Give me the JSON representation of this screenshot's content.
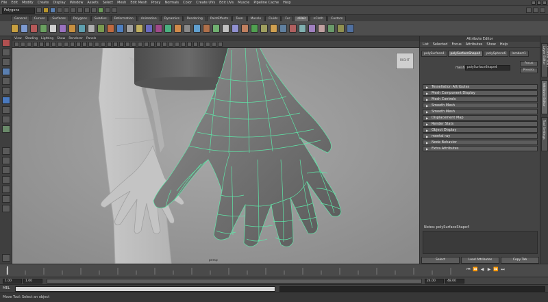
{
  "menubar": {
    "items": [
      "File",
      "Edit",
      "Modify",
      "Create",
      "Display",
      "Window",
      "Assets",
      "Select",
      "Mesh",
      "Edit Mesh",
      "Proxy",
      "Normals",
      "Color",
      "Create UVs",
      "Edit UVs",
      "Muscle",
      "Pipeline Cache",
      "Help"
    ]
  },
  "status": {
    "mode": "Polygons"
  },
  "shelf": {
    "tabs": [
      "General",
      "Curves",
      "Surfaces",
      "Polygons",
      "Subdivs",
      "Deformation",
      "Animation",
      "Dynamics",
      "Rendering",
      "PaintEffects",
      "Toon",
      "Muscle",
      "Fluids",
      "Fur",
      "nHair",
      "nCloth",
      "Custom"
    ],
    "active_tab": 14,
    "button_colors": [
      "#c8a040",
      "#7d9ad0",
      "#b65a5a",
      "#6aa060",
      "#d0d0d0",
      "#9a72c0",
      "#c89040",
      "#5fa0b0",
      "#b0b0b0",
      "#7a9a50",
      "#c06a40",
      "#5080c0",
      "#a0a0a0",
      "#c0b060",
      "#6a6ac0",
      "#a04a8a",
      "#4ab080",
      "#d08a4a",
      "#8a8a8a",
      "#60a0d0",
      "#b0704a",
      "#70b070",
      "#c0c0c0",
      "#9090d0",
      "#c08060",
      "#50a050",
      "#a0a060",
      "#d0a050",
      "#6080a0",
      "#b06060",
      "#80b0b0",
      "#a080c0",
      "#c0a0a0",
      "#6a9a6a",
      "#909050",
      "#5070a0"
    ]
  },
  "viewport": {
    "panel_menus": [
      "View",
      "Shading",
      "Lighting",
      "Show",
      "Renderer",
      "Panels"
    ],
    "viewcube_label": "RIGHT",
    "camera_label": "persp"
  },
  "attr": {
    "title": "Attribute Editor",
    "menus": [
      "List",
      "Selected",
      "Focus",
      "Attributes",
      "Show",
      "Help"
    ],
    "node_tabs": [
      "polySurface4",
      "polySurfaceShape4",
      "polySphere6",
      "lambert1"
    ],
    "active_tab": 1,
    "name_label": "mesh:",
    "name_value": "polySurfaceShape4",
    "focus_label": "Focus",
    "presets_label": "Presets",
    "sections": [
      "Tessellation Attributes",
      "Mesh Component Display",
      "Mesh Controls",
      "Smooth Mesh",
      "Smooth Mesh",
      "Displacement Map",
      "Render Stats",
      "Object Display",
      "mental ray",
      "Node Behavior",
      "Extra Attributes"
    ],
    "notes_label": "Notes: polySurfaceShape4",
    "buttons": [
      "Select",
      "Load Attributes",
      "Copy Tab"
    ]
  },
  "side_tabs": [
    "Channel Box / Layer Editor",
    "Attribute Editor",
    "Tool Settings"
  ],
  "time": {
    "start": "1.00",
    "end": "24.00",
    "range_start": "1.00",
    "range_end": "48.00",
    "current": "1"
  },
  "cmd": {
    "lang": "MEL"
  },
  "help": {
    "text": "Move Tool: Select an object"
  }
}
